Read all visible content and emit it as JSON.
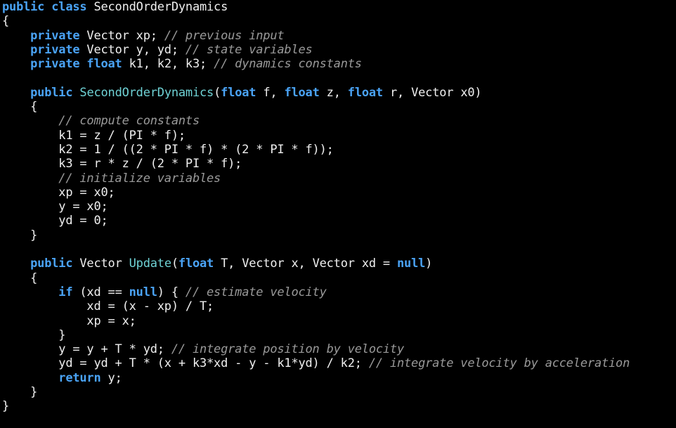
{
  "colors": {
    "background": "#000000",
    "keyword": "#4aa3f5",
    "function": "#6fd3d6",
    "comment": "#9a9a9a",
    "text": "#f0f0f0"
  },
  "code": {
    "lines": [
      [
        {
          "t": "kw",
          "v": "public class"
        },
        {
          "t": "tx",
          "v": " SecondOrderDynamics"
        }
      ],
      [
        {
          "t": "tx",
          "v": "{"
        }
      ],
      [
        {
          "t": "tx",
          "v": "    "
        },
        {
          "t": "kw",
          "v": "private"
        },
        {
          "t": "tx",
          "v": " Vector xp; "
        },
        {
          "t": "cm",
          "v": "// previous input"
        }
      ],
      [
        {
          "t": "tx",
          "v": "    "
        },
        {
          "t": "kw",
          "v": "private"
        },
        {
          "t": "tx",
          "v": " Vector y, yd; "
        },
        {
          "t": "cm",
          "v": "// state variables"
        }
      ],
      [
        {
          "t": "tx",
          "v": "    "
        },
        {
          "t": "kw",
          "v": "private float"
        },
        {
          "t": "tx",
          "v": " k1, k2, k3; "
        },
        {
          "t": "cm",
          "v": "// dynamics constants"
        }
      ],
      [
        {
          "t": "tx",
          "v": ""
        }
      ],
      [
        {
          "t": "tx",
          "v": "    "
        },
        {
          "t": "kw",
          "v": "public"
        },
        {
          "t": "tx",
          "v": " "
        },
        {
          "t": "fn",
          "v": "SecondOrderDynamics"
        },
        {
          "t": "tx",
          "v": "("
        },
        {
          "t": "kw",
          "v": "float"
        },
        {
          "t": "tx",
          "v": " f, "
        },
        {
          "t": "kw",
          "v": "float"
        },
        {
          "t": "tx",
          "v": " z, "
        },
        {
          "t": "kw",
          "v": "float"
        },
        {
          "t": "tx",
          "v": " r, Vector x0)"
        }
      ],
      [
        {
          "t": "tx",
          "v": "    {"
        }
      ],
      [
        {
          "t": "tx",
          "v": "        "
        },
        {
          "t": "cm",
          "v": "// compute constants"
        }
      ],
      [
        {
          "t": "tx",
          "v": "        k1 = z / (PI * f);"
        }
      ],
      [
        {
          "t": "tx",
          "v": "        k2 = 1 / ((2 * PI * f) * (2 * PI * f));"
        }
      ],
      [
        {
          "t": "tx",
          "v": "        k3 = r * z / (2 * PI * f);"
        }
      ],
      [
        {
          "t": "tx",
          "v": "        "
        },
        {
          "t": "cm",
          "v": "// initialize variables"
        }
      ],
      [
        {
          "t": "tx",
          "v": "        xp = x0;"
        }
      ],
      [
        {
          "t": "tx",
          "v": "        y = x0;"
        }
      ],
      [
        {
          "t": "tx",
          "v": "        yd = 0;"
        }
      ],
      [
        {
          "t": "tx",
          "v": "    }"
        }
      ],
      [
        {
          "t": "tx",
          "v": ""
        }
      ],
      [
        {
          "t": "tx",
          "v": "    "
        },
        {
          "t": "kw",
          "v": "public"
        },
        {
          "t": "tx",
          "v": " Vector "
        },
        {
          "t": "fn",
          "v": "Update"
        },
        {
          "t": "tx",
          "v": "("
        },
        {
          "t": "kw",
          "v": "float"
        },
        {
          "t": "tx",
          "v": " T, Vector x, Vector xd = "
        },
        {
          "t": "kw",
          "v": "null"
        },
        {
          "t": "tx",
          "v": ")"
        }
      ],
      [
        {
          "t": "tx",
          "v": "    {"
        }
      ],
      [
        {
          "t": "tx",
          "v": "        "
        },
        {
          "t": "kw",
          "v": "if"
        },
        {
          "t": "tx",
          "v": " (xd == "
        },
        {
          "t": "kw",
          "v": "null"
        },
        {
          "t": "tx",
          "v": ") { "
        },
        {
          "t": "cm",
          "v": "// estimate velocity"
        }
      ],
      [
        {
          "t": "tx",
          "v": "            xd = (x - xp) / T;"
        }
      ],
      [
        {
          "t": "tx",
          "v": "            xp = x;"
        }
      ],
      [
        {
          "t": "tx",
          "v": "        }"
        }
      ],
      [
        {
          "t": "tx",
          "v": "        y = y + T * yd; "
        },
        {
          "t": "cm",
          "v": "// integrate position by velocity"
        }
      ],
      [
        {
          "t": "tx",
          "v": "        yd = yd + T * (x + k3*xd - y - k1*yd) / k2; "
        },
        {
          "t": "cm",
          "v": "// integrate velocity by acceleration"
        }
      ],
      [
        {
          "t": "tx",
          "v": "        "
        },
        {
          "t": "kw",
          "v": "return"
        },
        {
          "t": "tx",
          "v": " y;"
        }
      ],
      [
        {
          "t": "tx",
          "v": "    }"
        }
      ],
      [
        {
          "t": "tx",
          "v": "}"
        }
      ]
    ]
  }
}
